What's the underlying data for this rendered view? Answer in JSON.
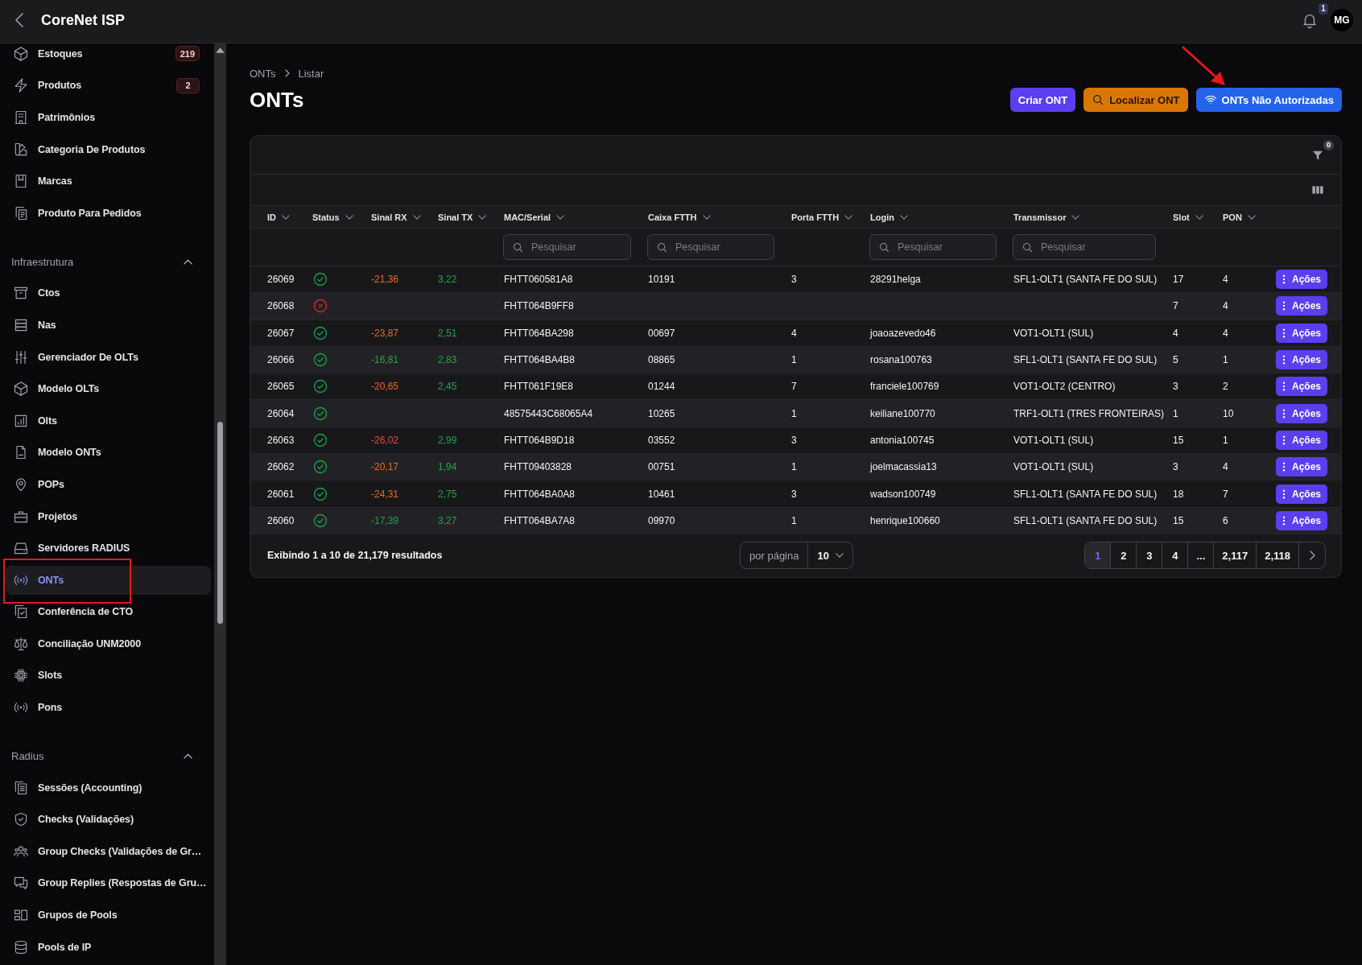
{
  "top_bar": {
    "title": "CoreNet ISP",
    "notification_count": "1",
    "avatar_initials": "MG"
  },
  "sidebar": {
    "sections": [
      {
        "items": [
          {
            "label": "Estoques",
            "badge": "219",
            "selected": false,
            "annotated": false
          },
          {
            "label": "Produtos",
            "badge": "2",
            "selected": false,
            "annotated": false
          },
          {
            "label": "Patrimônios",
            "selected": false,
            "annotated": false
          },
          {
            "label": "Categoria De Produtos",
            "selected": false,
            "annotated": false
          },
          {
            "label": "Marcas",
            "selected": false,
            "annotated": false
          },
          {
            "label": "Produto Para Pedidos",
            "selected": false,
            "annotated": false
          }
        ]
      },
      {
        "title": "Infraestrutura",
        "expanded": true,
        "items": [
          {
            "label": "Ctos",
            "selected": false,
            "annotated": false
          },
          {
            "label": "Nas",
            "selected": false,
            "annotated": false
          },
          {
            "label": "Gerenciador De OLTs",
            "selected": false,
            "annotated": false
          },
          {
            "label": "Modelo OLTs",
            "selected": false,
            "annotated": false
          },
          {
            "label": "Olts",
            "selected": false,
            "annotated": false
          },
          {
            "label": "Modelo ONTs",
            "selected": false,
            "annotated": false
          },
          {
            "label": "POPs",
            "selected": false,
            "annotated": false
          },
          {
            "label": "Projetos",
            "selected": false,
            "annotated": false
          },
          {
            "label": "Servidores RADIUS",
            "selected": false,
            "annotated": false
          },
          {
            "label": "ONTs",
            "selected": true,
            "annotated": true
          },
          {
            "label": "Conferência de CTO",
            "selected": false,
            "annotated": false
          },
          {
            "label": "Conciliação UNM2000",
            "selected": false,
            "annotated": false
          },
          {
            "label": "Slots",
            "selected": false,
            "annotated": false
          },
          {
            "label": "Pons",
            "selected": false,
            "annotated": false
          }
        ]
      },
      {
        "title": "Radius",
        "expanded": true,
        "items": [
          {
            "label": "Sessões (Accounting)",
            "selected": false,
            "annotated": false
          },
          {
            "label": "Checks (Validações)",
            "selected": false,
            "annotated": false
          },
          {
            "label": "Group Checks (Validações de Gr…",
            "selected": false,
            "annotated": false
          },
          {
            "label": "Group Replies (Respostas de Gru…",
            "selected": false,
            "annotated": false
          },
          {
            "label": "Grupos de Pools",
            "selected": false,
            "annotated": false
          },
          {
            "label": "Pools de IP",
            "selected": false,
            "annotated": false
          }
        ]
      }
    ]
  },
  "breadcrumb": [
    "ONTs",
    "Listar"
  ],
  "page_title": "ONTs",
  "header_actions": [
    {
      "label": "Criar ONT",
      "kind": "create",
      "annotated": false
    },
    {
      "label": "Localizar ONT",
      "kind": "locate",
      "annotated": false
    },
    {
      "label": "ONTs Não Autorizadas",
      "kind": "unauthorized",
      "annotated": true
    }
  ],
  "table": {
    "filter_count": "0",
    "columns": [
      {
        "label": "ID"
      },
      {
        "label": "Status"
      },
      {
        "label": "Sinal RX"
      },
      {
        "label": "Sinal TX"
      },
      {
        "label": "MAC/Serial",
        "placeholder": "Pesquisar"
      },
      {
        "label": "Caixa FTTH",
        "placeholder": "Pesquisar"
      },
      {
        "label": "Porta FTTH"
      },
      {
        "label": "Login",
        "placeholder": "Pesquisar"
      },
      {
        "label": "Transmissor",
        "placeholder": "Pesquisar"
      },
      {
        "label": "Slot"
      },
      {
        "label": "PON"
      }
    ],
    "rows": [
      {
        "id": "26069",
        "online": true,
        "sinal_rx": {
          "value": "-21,36",
          "color": "#ea6c1c"
        },
        "sinal_tx": {
          "value": "3,22",
          "color": "#22a447"
        },
        "mac_serial": "FHTT060581A8",
        "caixa_ftth": "10191",
        "porta_ftth": "3",
        "login": "28291helga",
        "transmissor": "SFL1-OLT1 (SANTA FE DO SUL)",
        "slot": "17",
        "pon": "4",
        "action": "Ações"
      },
      {
        "id": "26068",
        "online": false,
        "mac_serial": "FHTT064B9FF8",
        "slot": "7",
        "pon": "4",
        "action": "Ações"
      },
      {
        "id": "26067",
        "online": true,
        "sinal_rx": {
          "value": "-23,87",
          "color": "#ea6c1c"
        },
        "sinal_tx": {
          "value": "2,51",
          "color": "#22a447"
        },
        "mac_serial": "FHTT064BA298",
        "caixa_ftth": "00697",
        "porta_ftth": "4",
        "login": "joaoazevedo46",
        "transmissor": "VOT1-OLT1 (SUL)",
        "slot": "4",
        "pon": "4",
        "action": "Ações"
      },
      {
        "id": "26066",
        "online": true,
        "sinal_rx": {
          "value": "-16,81",
          "color": "#22a447"
        },
        "sinal_tx": {
          "value": "2,83",
          "color": "#22a447"
        },
        "mac_serial": "FHTT064BA4B8",
        "caixa_ftth": "08865",
        "porta_ftth": "1",
        "login": "rosana100763",
        "transmissor": "SFL1-OLT1 (SANTA FE DO SUL)",
        "slot": "5",
        "pon": "1",
        "action": "Ações"
      },
      {
        "id": "26065",
        "online": true,
        "sinal_rx": {
          "value": "-20,65",
          "color": "#ea6c1c"
        },
        "sinal_tx": {
          "value": "2,45",
          "color": "#22a447"
        },
        "mac_serial": "FHTT061F19E8",
        "caixa_ftth": "01244",
        "porta_ftth": "7",
        "login": "franciele100769",
        "transmissor": "VOT1-OLT2 (CENTRO)",
        "slot": "3",
        "pon": "2",
        "action": "Ações"
      },
      {
        "id": "26064",
        "online": true,
        "mac_serial": "48575443C68065A4",
        "caixa_ftth": "10265",
        "porta_ftth": "1",
        "login": "keiliane100770",
        "transmissor": "TRF1-OLT1 (TRES FRONTEIRAS)",
        "slot": "1",
        "pon": "10",
        "action": "Ações"
      },
      {
        "id": "26063",
        "online": true,
        "sinal_rx": {
          "value": "-26,02",
          "color": "#ef4444"
        },
        "sinal_tx": {
          "value": "2,99",
          "color": "#22a447"
        },
        "mac_serial": "FHTT064B9D18",
        "caixa_ftth": "03552",
        "porta_ftth": "3",
        "login": "antonia100745",
        "transmissor": "VOT1-OLT1 (SUL)",
        "slot": "15",
        "pon": "1",
        "action": "Ações"
      },
      {
        "id": "26062",
        "online": true,
        "sinal_rx": {
          "value": "-20,17",
          "color": "#ea6c1c"
        },
        "sinal_tx": {
          "value": "1,94",
          "color": "#22a447"
        },
        "mac_serial": "FHTT09403828",
        "caixa_ftth": "00751",
        "porta_ftth": "1",
        "login": "joelmacassia13",
        "transmissor": "VOT1-OLT1 (SUL)",
        "slot": "3",
        "pon": "4",
        "action": "Ações"
      },
      {
        "id": "26061",
        "online": true,
        "sinal_rx": {
          "value": "-24,31",
          "color": "#ea6c1c"
        },
        "sinal_tx": {
          "value": "2,75",
          "color": "#22a447"
        },
        "mac_serial": "FHTT064BA0A8",
        "caixa_ftth": "10461",
        "porta_ftth": "3",
        "login": "wadson100749",
        "transmissor": "SFL1-OLT1 (SANTA FE DO SUL)",
        "slot": "18",
        "pon": "7",
        "action": "Ações"
      },
      {
        "id": "26060",
        "online": true,
        "sinal_rx": {
          "value": "-17,39",
          "color": "#22a447"
        },
        "sinal_tx": {
          "value": "3,27",
          "color": "#22a447"
        },
        "mac_serial": "FHTT064BA7A8",
        "caixa_ftth": "09970",
        "porta_ftth": "1",
        "login": "henrique100660",
        "transmissor": "SFL1-OLT1 (SANTA FE DO SUL)",
        "slot": "15",
        "pon": "6",
        "action": "Ações"
      }
    ],
    "summary": "Exibindo 1 a 10 de 21,179 resultados",
    "per_page": {
      "label": "por página",
      "value": "10"
    },
    "pages": [
      {
        "label": "1",
        "selected": true
      },
      {
        "label": "2",
        "selected": false
      },
      {
        "label": "3",
        "selected": false
      },
      {
        "label": "4",
        "selected": false
      },
      {
        "label": "...",
        "selected": false
      },
      {
        "label": "2,117",
        "selected": false
      },
      {
        "label": "2,118",
        "selected": false
      }
    ]
  }
}
